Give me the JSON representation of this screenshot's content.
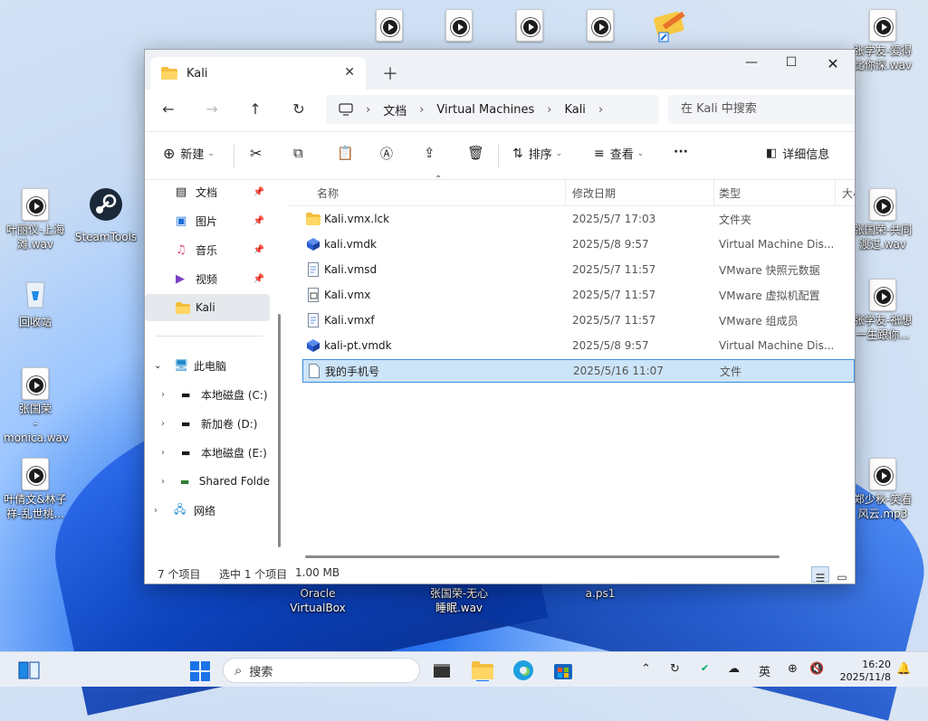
{
  "desktop": {
    "icons": [
      {
        "label": "张学友-爱得比你深.wav",
        "line1": "张学友-爱得",
        "line2": "比你深.wav"
      },
      {
        "label": "叶丽仪-上海滩.wav",
        "line1": "叶丽仪-上海",
        "line2": "滩.wav"
      },
      {
        "label": "SteamTools",
        "line1": "SteamTools",
        "line2": ""
      },
      {
        "label": "回收站",
        "line1": "回收站",
        "line2": ""
      },
      {
        "label": "张国荣-monica.wav",
        "line1": "张国荣",
        "line2": "-monica.wav"
      },
      {
        "label": "叶倩文&林子祥-乱世桃...",
        "line1": "叶倩文&林子",
        "line2": "祥-乱世桃..."
      },
      {
        "label": "张国荣-共同渡过.wav",
        "line1": "张国荣-共同",
        "line2": "渡过.wav"
      },
      {
        "label": "张学友-祇想一生跟你...",
        "line1": "张学友-祇想",
        "line2": "一生跟你..."
      },
      {
        "label": "郑少秋-笑看风云.mp3",
        "line1": "郑少秋-笑看",
        "line2": "风云.mp3"
      },
      {
        "label": "Oracle VirtualBox",
        "line1": "Oracle",
        "line2": "VirtualBox"
      },
      {
        "label": "张国荣-无心睡眠.wav",
        "line1": "张国荣-无心",
        "line2": "睡眠.wav"
      },
      {
        "label": "a.ps1",
        "line1": "a.ps1",
        "line2": ""
      }
    ]
  },
  "window": {
    "tab_title": "Kali",
    "breadcrumb": [
      "文档",
      "Virtual Machines",
      "Kali"
    ],
    "search_placeholder": "在 Kali 中搜索",
    "toolbar": {
      "new_label": "新建",
      "sort_label": "排序",
      "view_label": "查看",
      "more_label": "···",
      "details_label": "详细信息"
    },
    "nav": {
      "quick": [
        {
          "label": "文档",
          "icon": "documents-icon"
        },
        {
          "label": "图片",
          "icon": "pictures-icon"
        },
        {
          "label": "音乐",
          "icon": "music-icon"
        },
        {
          "label": "视频",
          "icon": "videos-icon"
        },
        {
          "label": "Kali",
          "icon": "folder-icon"
        }
      ],
      "this_pc": "此电脑",
      "drives": [
        {
          "label": "本地磁盘 (C:)"
        },
        {
          "label": "新加卷 (D:)"
        },
        {
          "label": "本地磁盘 (E:)"
        },
        {
          "label": "Shared Folde"
        }
      ],
      "network": "网络"
    },
    "columns": {
      "name": "名称",
      "date": "修改日期",
      "type": "类型",
      "size": "大小"
    },
    "files": [
      {
        "name": "Kali.vmx.lck",
        "date": "2025/5/7 17:03",
        "type": "文件夹",
        "icon": "folder-icon"
      },
      {
        "name": "kali.vmdk",
        "date": "2025/5/8 9:57",
        "type": "Virtual Machine Dis...",
        "icon": "vmdk-icon"
      },
      {
        "name": "Kali.vmsd",
        "date": "2025/5/7 11:57",
        "type": "VMware 快照元数据",
        "icon": "vmsd-icon"
      },
      {
        "name": "Kali.vmx",
        "date": "2025/5/7 11:57",
        "type": "VMware 虚拟机配置",
        "icon": "vmx-icon"
      },
      {
        "name": "Kali.vmxf",
        "date": "2025/5/7 11:57",
        "type": "VMware 组成员",
        "icon": "vmxf-icon"
      },
      {
        "name": "kali-pt.vmdk",
        "date": "2025/5/8 9:57",
        "type": "Virtual Machine Dis...",
        "icon": "vmdk-icon"
      },
      {
        "name": "我的手机号",
        "date": "2025/5/16 11:07",
        "type": "文件",
        "icon": "file-icon",
        "selected": true
      }
    ],
    "status": {
      "count": "7 个项目",
      "selected": "选中 1 个项目",
      "size": "1.00 MB"
    }
  },
  "taskbar": {
    "search_label": "搜索",
    "ime": "英",
    "time": "16:20",
    "date": "2025/11/8"
  }
}
